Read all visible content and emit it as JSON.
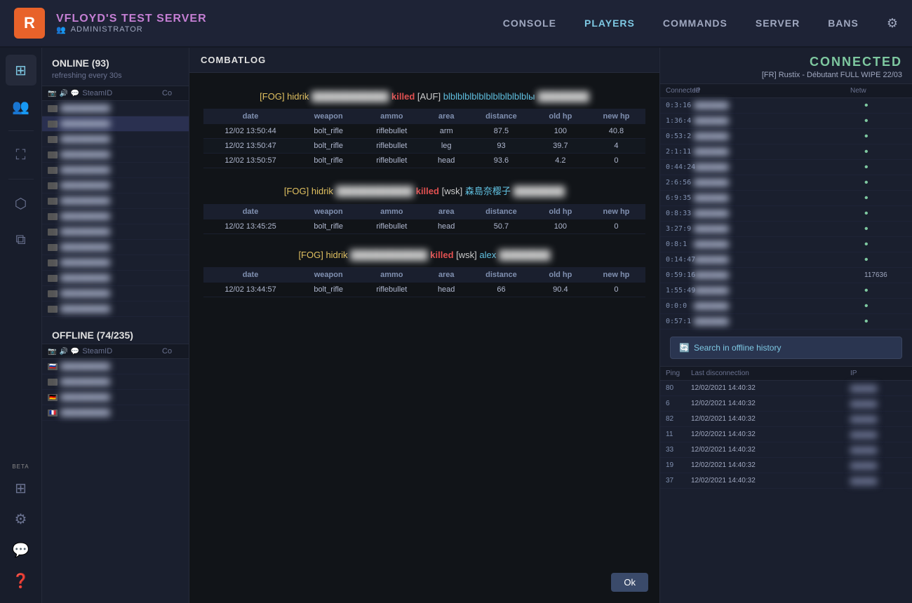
{
  "topnav": {
    "logo": "R",
    "server_name": "VFLOYD'S TEST SERVER",
    "role": "ADMINISTRATOR",
    "links": [
      {
        "label": "CONSOLE",
        "active": false
      },
      {
        "label": "PLAYERS",
        "active": true
      },
      {
        "label": "COMMANDS",
        "active": false
      },
      {
        "label": "SERVER",
        "active": false
      },
      {
        "label": "BANS",
        "active": false
      }
    ]
  },
  "online_section": {
    "title": "ONLINE (93)",
    "sub": "refreshing every 30s",
    "table_headers": [
      "SteamID",
      "Co"
    ],
    "offline_title": "OFFLINE (74/235)"
  },
  "combatlog": {
    "title": "COMBATLOG",
    "events": [
      {
        "killer": "[FOG] hidrik",
        "action": "killed",
        "victim_tag": "[AUF]",
        "victim_name": "blblblblblblblblblblblblы",
        "rows": [
          {
            "date": "12/02 13:50:44",
            "weapon": "bolt_rifle",
            "ammo": "riflebullet",
            "area": "arm",
            "distance": "87.5",
            "old_hp": "100",
            "new_hp": "40.8"
          },
          {
            "date": "12/02 13:50:47",
            "weapon": "bolt_rifle",
            "ammo": "riflebullet",
            "area": "leg",
            "distance": "93",
            "old_hp": "39.7",
            "new_hp": "4"
          },
          {
            "date": "12/02 13:50:57",
            "weapon": "bolt_rifle",
            "ammo": "riflebullet",
            "area": "head",
            "distance": "93.6",
            "old_hp": "4.2",
            "new_hp": "0"
          }
        ]
      },
      {
        "killer": "[FOG] hidrik",
        "action": "killed",
        "victim_tag": "[wsk]",
        "victim_name": "森島奈樱子",
        "rows": [
          {
            "date": "12/02 13:45:25",
            "weapon": "bolt_rifle",
            "ammo": "riflebullet",
            "area": "head",
            "distance": "50.7",
            "old_hp": "100",
            "new_hp": "0"
          }
        ]
      },
      {
        "killer": "[FOG] hidrik",
        "action": "killed",
        "victim_tag": "[wsk]",
        "victim_name": "alex",
        "rows": [
          {
            "date": "12/02 13:44:57",
            "weapon": "bolt_rifle",
            "ammo": "riflebullet",
            "area": "head",
            "distance": "66",
            "old_hp": "90.4",
            "new_hp": "0"
          }
        ]
      }
    ],
    "table_col_headers": [
      "date",
      "weapon",
      "ammo",
      "area",
      "distance",
      "old hp",
      "new hp"
    ],
    "ok_button": "Ok"
  },
  "right_panel": {
    "connected_label": "CONNECTED",
    "connected_sub": "[FR] Rustix - Débutant FULL WIPE 22/03",
    "table_headers": [
      "Connected",
      "IP",
      "Netw"
    ],
    "rows": [
      {
        "connected": "0:3:16",
        "ip": "blurred",
        "network": "•"
      },
      {
        "connected": "1:36:4",
        "ip": "blurred",
        "network": "•"
      },
      {
        "connected": "0:53:2",
        "ip": "blurred",
        "network": "•"
      },
      {
        "connected": "2:1:11",
        "ip": "blurred",
        "network": "•"
      },
      {
        "connected": "0:44:24",
        "ip": "blurred",
        "network": "•"
      },
      {
        "connected": "2:6:56",
        "ip": "blurred",
        "network": "•"
      },
      {
        "connected": "6:9:35",
        "ip": "blurred",
        "network": "•"
      },
      {
        "connected": "0:8:33",
        "ip": "blurred",
        "network": "•"
      },
      {
        "connected": "3:27:9",
        "ip": "blurred",
        "network": "•"
      },
      {
        "connected": "0:8:1",
        "ip": "blurred",
        "network": "•"
      },
      {
        "connected": "0:14:47",
        "ip": "blurred",
        "network": "•"
      },
      {
        "connected": "0:59:16",
        "ip": "blurred",
        "network": "117636"
      },
      {
        "connected": "1:55:49",
        "ip": "blurred",
        "network": "•"
      },
      {
        "connected": "0:0:0",
        "ip": "blurred",
        "network": "•"
      },
      {
        "connected": "0:57:1",
        "ip": "blurred",
        "network": "•"
      }
    ],
    "search_offline_btn": "Search in offline history",
    "offline_table_headers": [
      "Ping",
      "Last disconnection",
      "IP"
    ],
    "offline_rows": [
      {
        "ping": "80",
        "last_dc": "12/02/2021 14:40:32",
        "ip": "blurred"
      },
      {
        "ping": "6",
        "last_dc": "12/02/2021 14:40:32",
        "ip": "blurred"
      },
      {
        "ping": "82",
        "last_dc": "12/02/2021 14:40:32",
        "ip": "blurred"
      },
      {
        "ping": "11",
        "last_dc": "12/02/2021 14:40:32",
        "ip": "blurred"
      },
      {
        "ping": "33",
        "last_dc": "12/02/2021 14:40:32",
        "ip": "blurred"
      },
      {
        "ping": "19",
        "last_dc": "12/02/2021 14:40:32",
        "ip": "blurred"
      },
      {
        "ping": "37",
        "last_dc": "12/02/2021 14:40:32",
        "ip": "blurred"
      }
    ]
  }
}
